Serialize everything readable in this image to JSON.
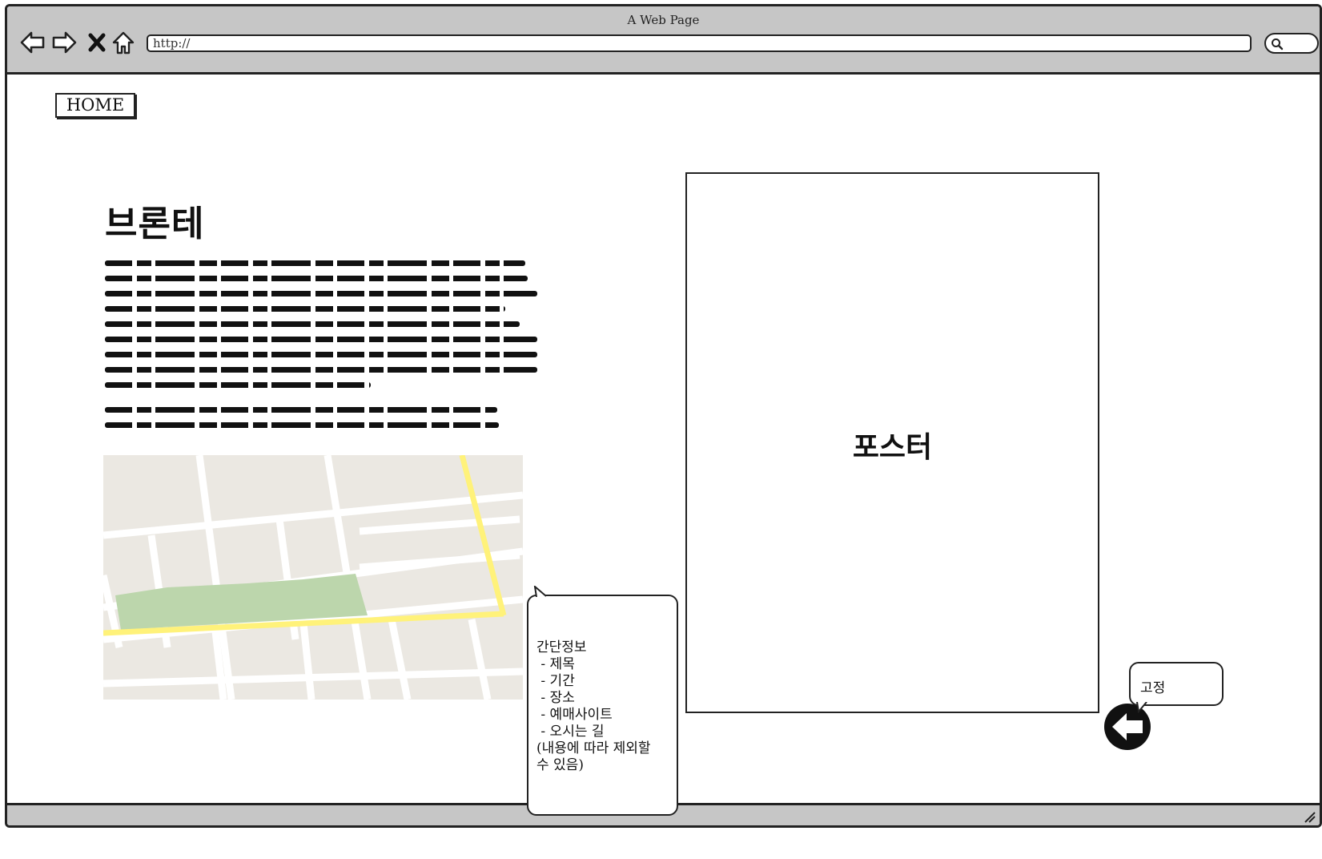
{
  "window": {
    "title": "A Web Page",
    "url": "http://"
  },
  "nav": {
    "back_icon": "back-arrow-icon",
    "forward_icon": "forward-arrow-icon",
    "close_icon": "close-x-icon",
    "home_icon": "home-icon",
    "search_icon": "search-icon"
  },
  "page": {
    "home_button": "HOME",
    "title": "브론테",
    "poster_label": "포스터",
    "fixed_callout": "고정",
    "fixed_button_icon": "back-circle-arrow-icon",
    "info_callout": {
      "lines": [
        "간단정보",
        " - 제목",
        " - 기간",
        " - 장소",
        " - 예매사이트",
        " - 오시는 길",
        "(내용에 따라 제외할",
        "수 있음)"
      ]
    },
    "map_placeholder": "map-image"
  },
  "colors": {
    "chrome": "#c6c6c6",
    "map_bg": "#ebe8e2",
    "map_road_highlight": "#fff27a",
    "map_park": "#bcd6ac"
  }
}
